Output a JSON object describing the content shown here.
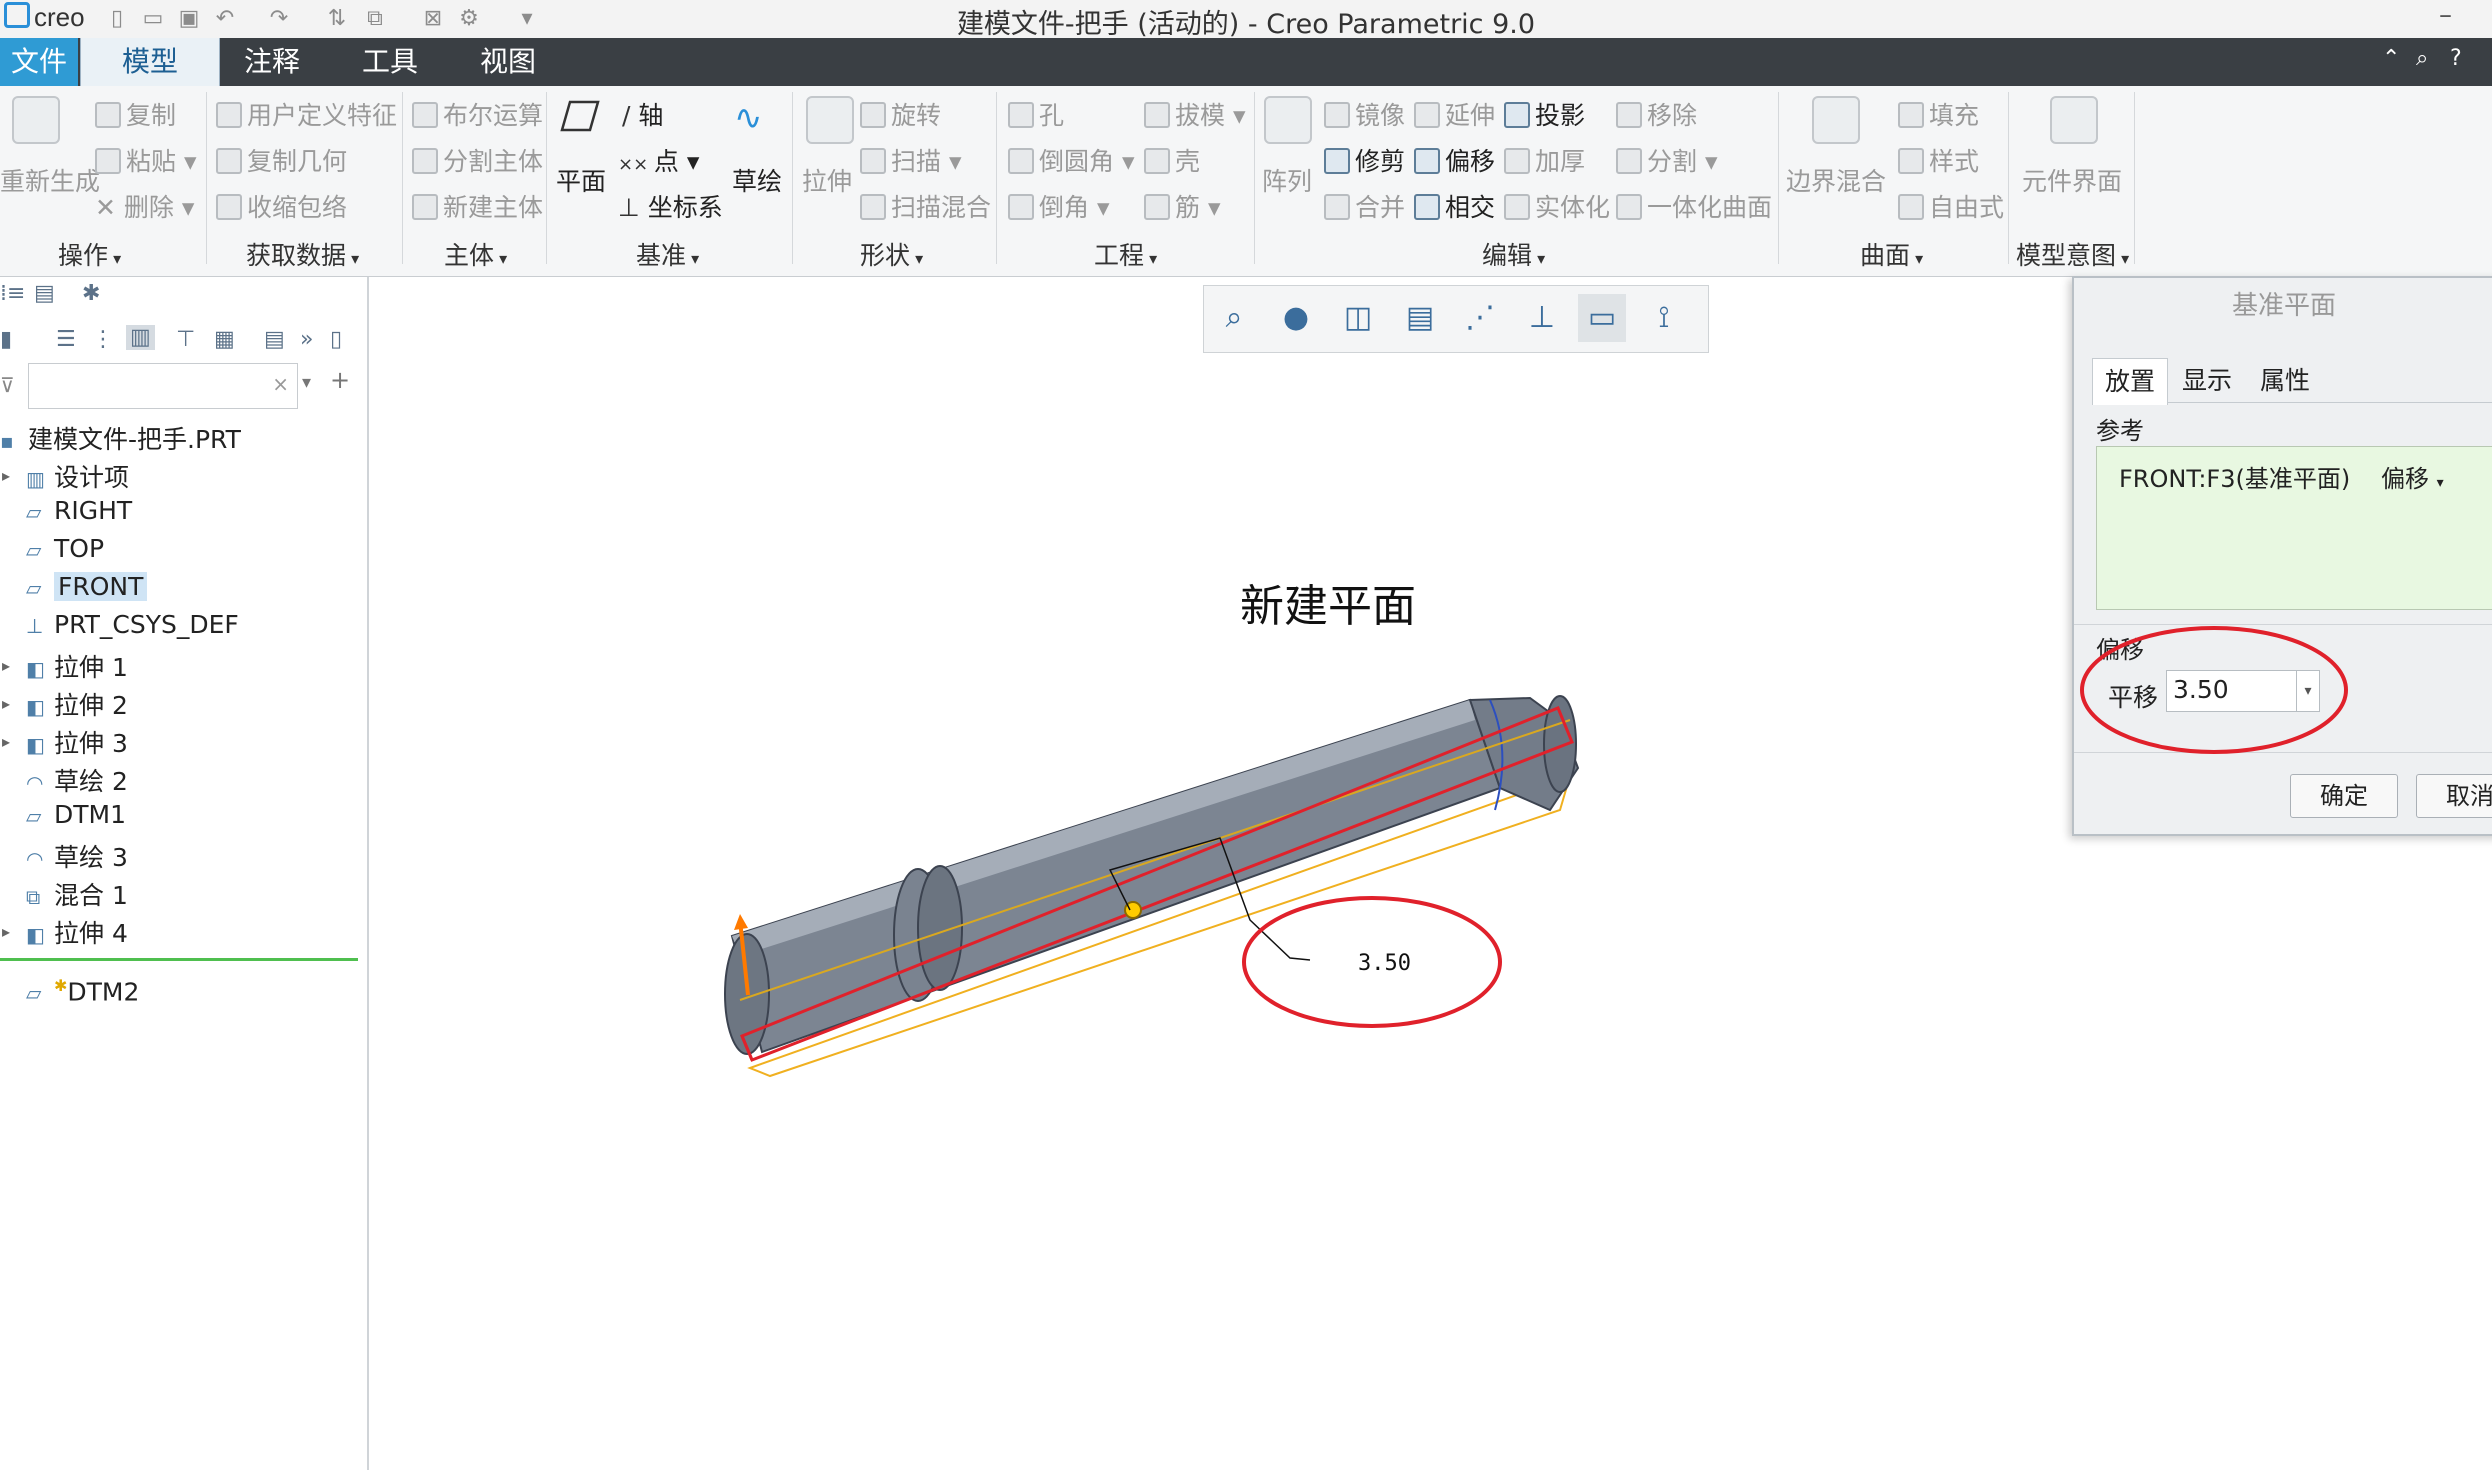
{
  "app": {
    "logo": "creo",
    "window_title": "建模文件-把手 (活动的) - Creo Parametric 9.0"
  },
  "tabs": [
    "文件",
    "模型",
    "注释",
    "工具",
    "视图"
  ],
  "ribbon": {
    "groups": [
      "操作",
      "获取数据",
      "主体",
      "基准",
      "形状",
      "工程",
      "编辑",
      "曲面",
      "模型意图"
    ],
    "operations": {
      "regenerate": "重新生成",
      "copy": "复制",
      "paste": "粘贴",
      "delete": "删除"
    },
    "get_data": {
      "udf": "用户定义特征",
      "copy_geom": "复制几何",
      "shrinkwrap": "收缩包络"
    },
    "body": {
      "boolean": "布尔运算",
      "split_body": "分割主体",
      "new_body": "新建主体"
    },
    "datum": {
      "plane": "平面",
      "axis": "轴",
      "point": "点",
      "csys": "坐标系",
      "sketch": "草绘"
    },
    "shapes": {
      "extrude": "拉伸",
      "revolve": "旋转",
      "sweep": "扫描",
      "swept_blend": "扫描混合"
    },
    "engineering": {
      "hole": "孔",
      "round": "倒圆角",
      "chamfer": "倒角",
      "draft": "拔模",
      "shell": "壳",
      "rib": "筋"
    },
    "editing": {
      "pattern": "阵列",
      "mirror": "镜像",
      "extend": "延伸",
      "project": "投影",
      "trim": "修剪",
      "offset": "偏移",
      "thicken": "加厚",
      "merge": "合并",
      "intersect": "相交",
      "solidify": "实体化",
      "remove": "移除",
      "split": "分割",
      "unify": "一体化曲面"
    },
    "surfaces": {
      "boundary_blend": "边界混合",
      "fill": "填充",
      "style": "样式",
      "freestyle": "自由式"
    },
    "model_intent": {
      "component_interface": "元件界面"
    }
  },
  "model_tree": {
    "filter_placeholder": "",
    "items": [
      {
        "label": "建模文件-把手.PRT",
        "icon": "part-icon",
        "expandable": false
      },
      {
        "label": "设计项",
        "icon": "design-items-icon",
        "expandable": true
      },
      {
        "label": "RIGHT",
        "icon": "datum-plane-icon",
        "expandable": false
      },
      {
        "label": "TOP",
        "icon": "datum-plane-icon",
        "expandable": false
      },
      {
        "label": "FRONT",
        "icon": "datum-plane-icon",
        "expandable": false,
        "selected": true
      },
      {
        "label": "PRT_CSYS_DEF",
        "icon": "csys-icon",
        "expandable": false
      },
      {
        "label": "拉伸 1",
        "icon": "extrude-icon",
        "expandable": true
      },
      {
        "label": "拉伸 2",
        "icon": "extrude-icon",
        "expandable": true
      },
      {
        "label": "拉伸 3",
        "icon": "extrude-icon",
        "expandable": true
      },
      {
        "label": "草绘 2",
        "icon": "sketch-icon",
        "expandable": false
      },
      {
        "label": "DTM1",
        "icon": "datum-plane-icon",
        "expandable": false
      },
      {
        "label": "草绘 3",
        "icon": "sketch-icon",
        "expandable": false
      },
      {
        "label": "混合 1",
        "icon": "blend-icon",
        "expandable": false
      },
      {
        "label": "拉伸 4",
        "icon": "extrude-icon",
        "expandable": true
      }
    ],
    "new_item": "DTM2"
  },
  "graphics": {
    "heading": "新建平面",
    "dimension": "3.50"
  },
  "dialog": {
    "title": "基准平面",
    "tabs": [
      "放置",
      "显示",
      "属性"
    ],
    "references_label": "参考",
    "reference_entry": "FRONT:F3(基准平面)",
    "reference_type": "偏移",
    "offset_label": "偏移",
    "translation_label": "平移",
    "translation_value": "3.50",
    "ok": "确定",
    "cancel": "取消"
  },
  "colors": {
    "accent": "#2f9bd4",
    "tabbar": "#3a3f44",
    "annotation_red": "#e0212b",
    "reference_green": "#e8f8e1",
    "part_gray": "#7c8592"
  }
}
